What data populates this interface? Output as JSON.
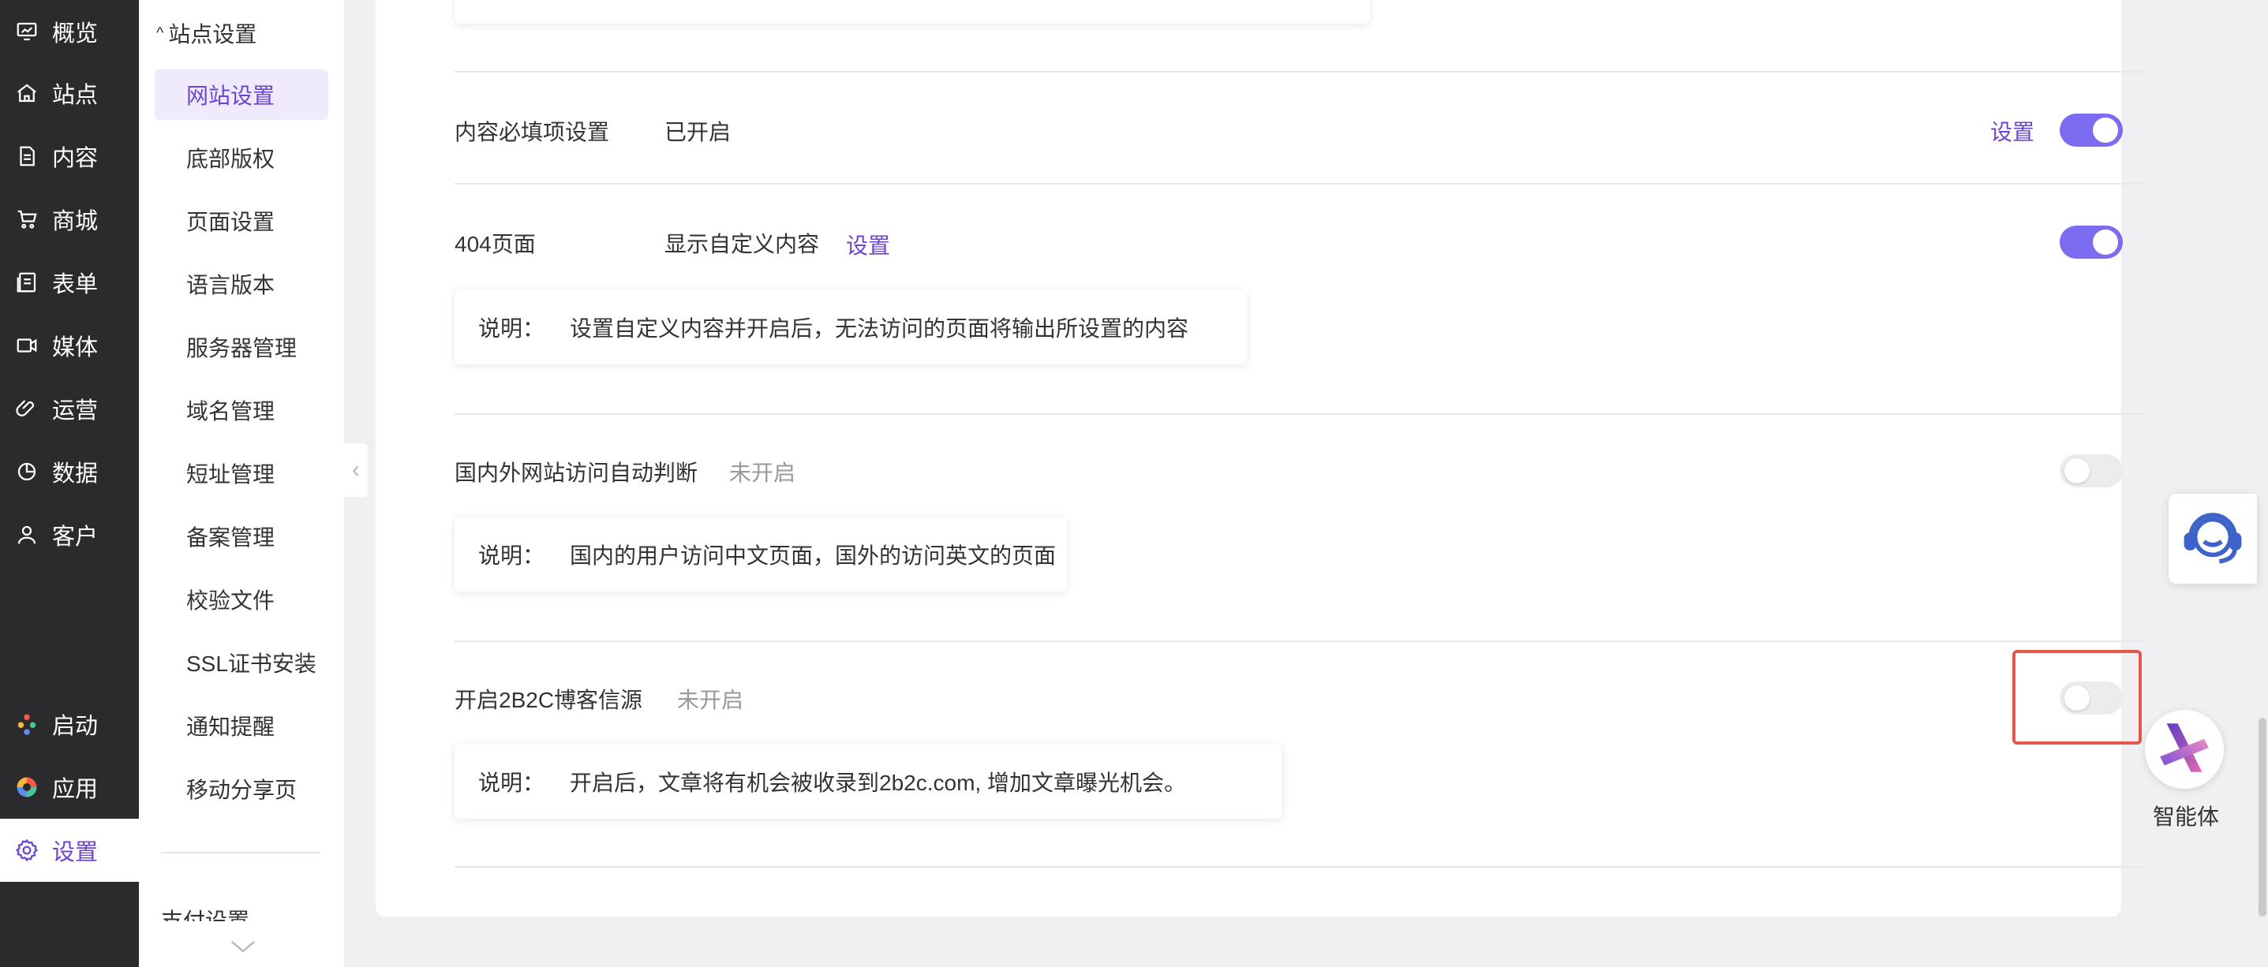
{
  "rail": {
    "items": [
      {
        "label": "概览",
        "icon": "overview-icon"
      },
      {
        "label": "站点",
        "icon": "home-icon"
      },
      {
        "label": "内容",
        "icon": "document-icon"
      },
      {
        "label": "商城",
        "icon": "cart-icon"
      },
      {
        "label": "表单",
        "icon": "form-icon"
      },
      {
        "label": "媒体",
        "icon": "video-icon"
      },
      {
        "label": "运营",
        "icon": "paperclip-icon"
      },
      {
        "label": "数据",
        "icon": "pie-chart-icon"
      },
      {
        "label": "客户",
        "icon": "user-icon"
      }
    ],
    "bottom": [
      {
        "label": "启动",
        "icon": "launch-icon"
      },
      {
        "label": "应用",
        "icon": "apps-icon"
      },
      {
        "label": "设置",
        "icon": "gear-icon"
      }
    ]
  },
  "submenu": {
    "group": "站点设置",
    "items": [
      "网站设置",
      "底部版权",
      "页面设置",
      "语言版本",
      "服务器管理",
      "域名管理",
      "短址管理",
      "备案管理",
      "校验文件",
      "SSL证书安装",
      "通知提醒",
      "移动分享页"
    ],
    "group2": "支付设置"
  },
  "settings": [
    {
      "label": "内容必填项设置",
      "status": "已开启",
      "link": "设置",
      "enabled": true
    },
    {
      "label": "404页面",
      "status": "显示自定义内容",
      "link": "设置",
      "enabled": true,
      "desc_label": "说明：",
      "desc": "设置自定义内容并开启后，无法访问的页面将输出所设置的内容"
    },
    {
      "label": "国内外网站访问自动判断",
      "status": "未开启",
      "enabled": false,
      "desc_label": "说明：",
      "desc": "国内的用户访问中文页面，国外的访问英文的页面"
    },
    {
      "label": "开启2B2C博客信源",
      "status": "未开启",
      "enabled": false,
      "desc_label": "说明：",
      "desc": "开启后，文章将有机会被收录到2b2c.com, 增加文章曝光机会。"
    }
  ],
  "agent": {
    "label": "智能体"
  },
  "colors": {
    "accent": "#6d45d3",
    "toggle_on": "#7b6cf0",
    "highlight": "#e5564b",
    "rail_bg": "#2b2b2d"
  }
}
